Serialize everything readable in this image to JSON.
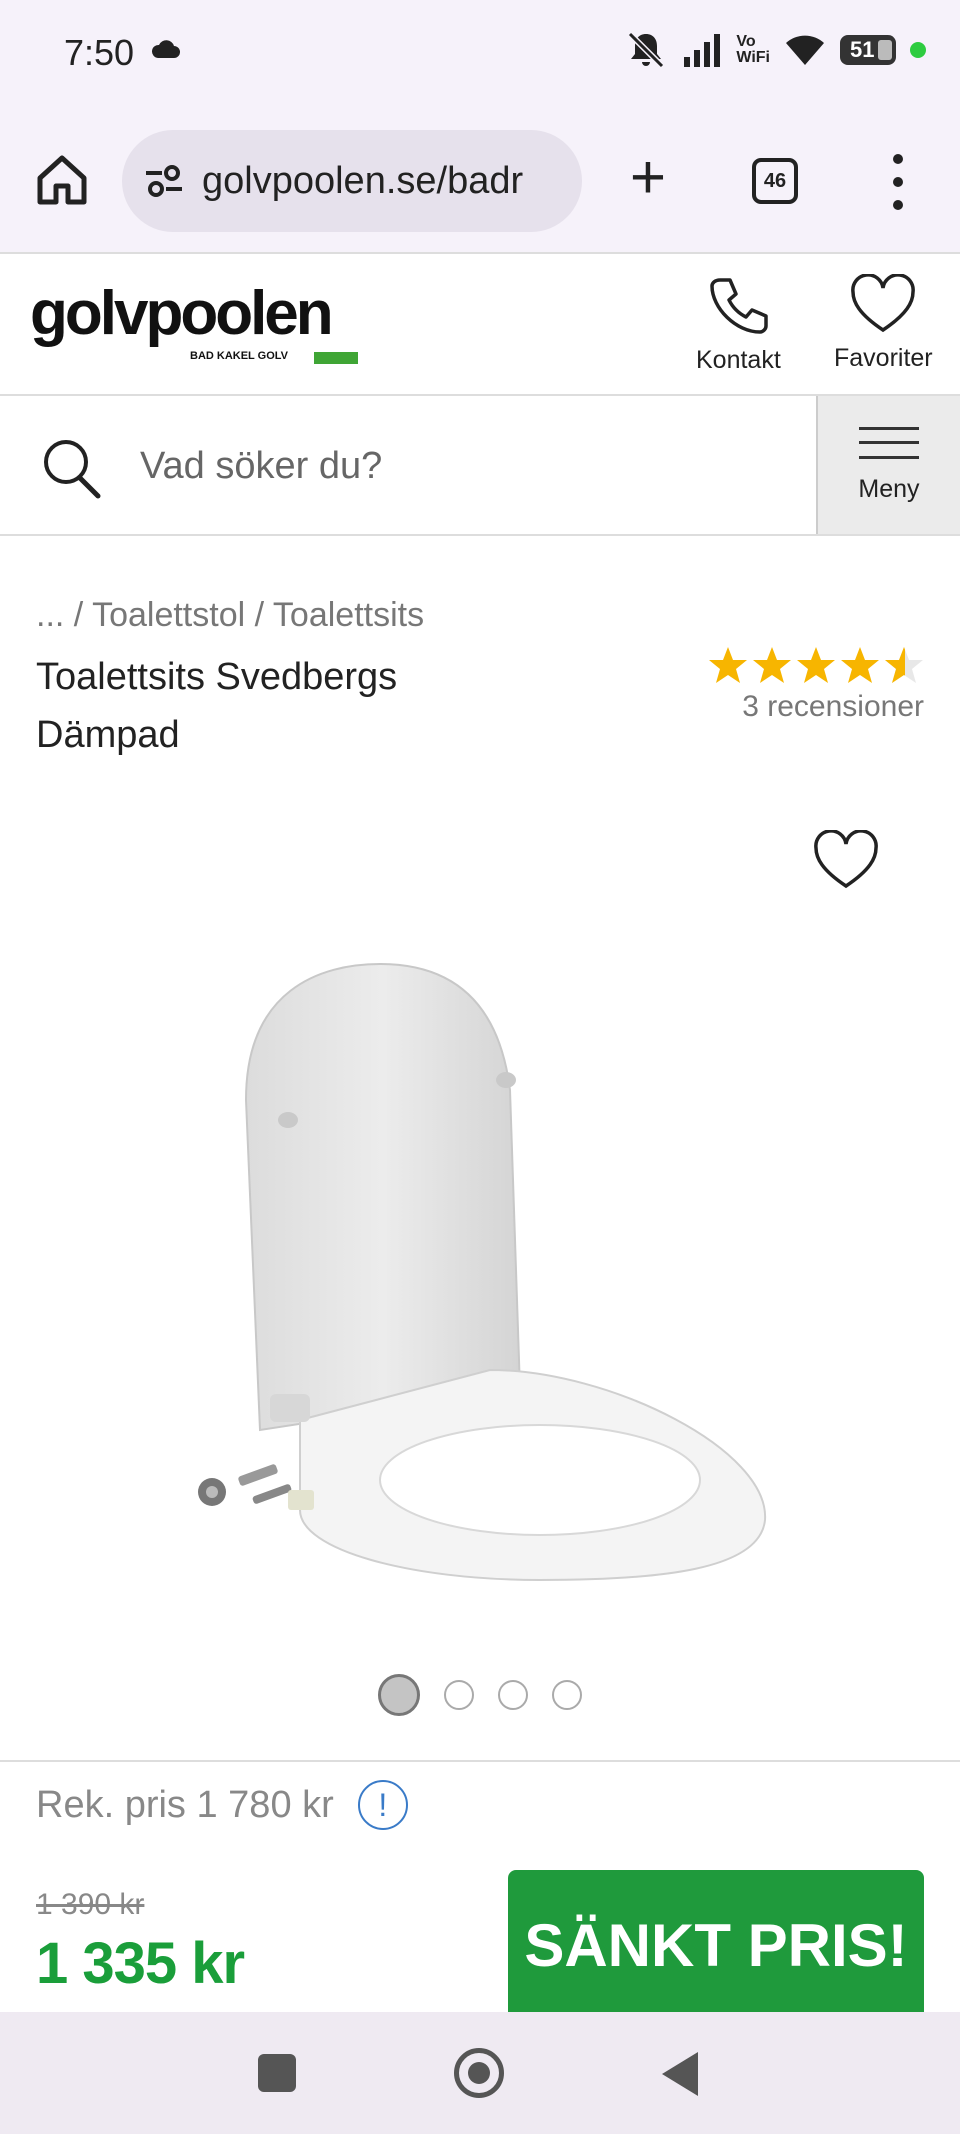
{
  "status": {
    "time": "7:50",
    "battery": "51",
    "network": "Vo\nWiFi"
  },
  "browser": {
    "url": "golvpoolen.se/badr",
    "tab_count": "46"
  },
  "site": {
    "logo": "golvpoolen",
    "logo_sub": "BAD KAKEL GOLV",
    "contact_label": "Kontakt",
    "favorites_label": "Favoriter",
    "search_placeholder": "Vad söker du?",
    "menu_label": "Meny"
  },
  "product": {
    "breadcrumb": [
      "...",
      "Toalettstol",
      "Toalettsits"
    ],
    "title": "Toalettsits Svedbergs Dämpad",
    "rating": 4.5,
    "reviews": "3 recensioner",
    "image_count": 4,
    "active_image": 0,
    "rek_price": "Rek. pris 1 780 kr",
    "old_price": "1 390 kr",
    "new_price": "1 335 kr",
    "badge": "SÄNKT PRIS!"
  },
  "colors": {
    "brand_green": "#1f9a3c",
    "star": "#f7b500",
    "info_blue": "#3a7bc8"
  }
}
